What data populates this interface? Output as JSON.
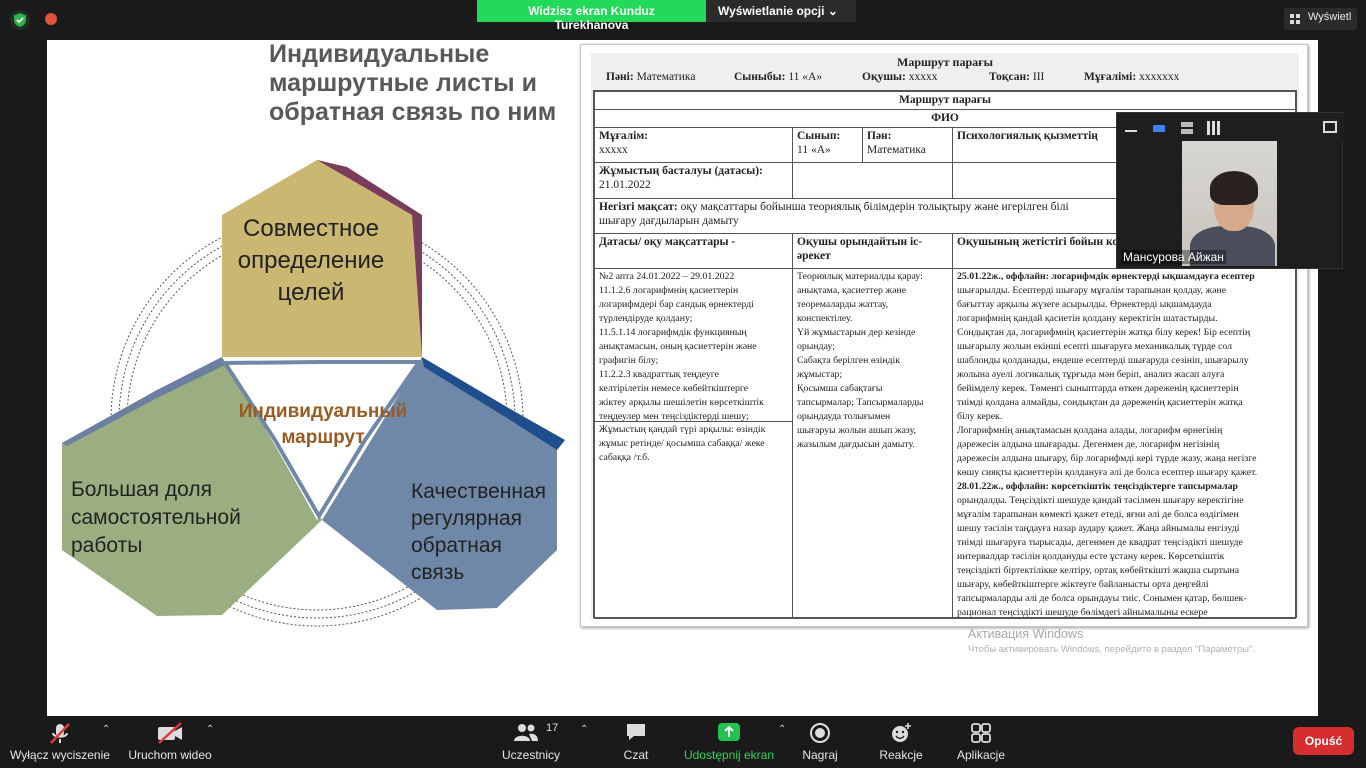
{
  "top_bar": {
    "share_banner": "Widzisz ekran Kunduz Turekhanova",
    "view_options": "Wyświetlanie opcji",
    "view_button": "Wyświetl"
  },
  "slide": {
    "title": "Индивидуальные маршрутные листы и обратная связь по ним",
    "diagram": {
      "top": [
        "Совместное",
        "определение",
        "целей"
      ],
      "left": [
        "Большая доля",
        "самостоятельной",
        "работы"
      ],
      "right": [
        "Качественная",
        "регулярная",
        "обратная",
        "связь"
      ],
      "center": [
        "Индивидуальный",
        "маршрут"
      ],
      "colors": {
        "top": "#c9b772",
        "left": "#9aae82",
        "right": "#6f88a8",
        "center_text": "#9b5a1f"
      }
    }
  },
  "document": {
    "header_title": "Маршрут парағы",
    "subject_label": "Пәні:",
    "subject_value": "Математика",
    "class_label": "Сыныбы:",
    "class_value": "11 «А»",
    "student_label": "Оқушы:",
    "student_value": "xxxxx",
    "quarter_label": "Тоқсан:",
    "quarter_value": "III",
    "teacher_label": "Мұғалімі:",
    "teacher_value": "xxxxxxx",
    "table_title": "Маршрут парағы",
    "fio": "ФИО",
    "teacher_cell_label": "Мұғалім:",
    "teacher_cell_value": "xxxxx",
    "class_cell_label": "Сынып:",
    "class_cell_value": "11 «А»",
    "subject_cell_label": "Пән:",
    "subject_cell_value": "Математика",
    "psych_label": "Психологиялық қызметтің",
    "start_label": "Жұмыстың басталуы (датасы):",
    "start_value": "21.01.2022",
    "goal_label": "Негізгі мақсат:",
    "goal_value": "оқу мақсаттары бойынша теориялық білімдерін толықтыру және игерілген білі",
    "goal_value2": "шығару дағдыларын дамыту",
    "col1_header": "Датасы/ оқу мақсаттары -",
    "col2_header": "Оқушы орындайтын іс-әрекет",
    "col3_header": "Оқушының жетістігі бойын комментарии",
    "col1_lines": [
      "№2 апта 24.01.2022 – 29.01.2022",
      "11.1.2.6 логарифмнің қасиеттерін",
      "логарифмдері бар сандық өрнектерді",
      "түрлендіруде қолдану;",
      "11.5.1.14 логарифмдік функцияның",
      "анықтамасын, оның қасиеттерін және",
      "графигін білу;",
      "11.2.2.3 квадраттық теңдеуге",
      "келтірілетін немесе көбейткіштерге",
      "жіктеу арқылы шешілетін көрсеткіштік",
      "теңдеулер мен теңсіздіктерді шешу;"
    ],
    "col1_lower": [
      "Жұмыстың қандай түрі арқылы: өзіндік",
      "жұмыс ретінде/ қосымша сабаққа/ жеке",
      "сабаққа /т.б."
    ],
    "col2_lines": [
      "Теориялық материалды қарау:",
      "анықтама, қасиеттер және",
      "теоремаларды жаттау,",
      "конспектілеу.",
      "Үй жұмыстарын дер кезінде",
      "орындау;",
      "Сабақта берілген өзіндік",
      "жұмыстар;",
      "Қосымша сабақтағы",
      "тапсырмалар; Тапсырмаларды",
      "орындауда толығымен",
      "шығаруы жолын ашып жазу,",
      "жазылым дағдысын дамыту."
    ],
    "col3_lines": [
      "25.01.22ж., оффлайн: логарифмдік өрнектерді ықшамдауға есептер",
      "шығарылды. Есептерді шығару мұғалім тарапынан қолдау, және",
      "бағыттау арқылы жүзеге асырылды. Өрнектерді ықшамдауда",
      "логарифмнің қандай қасиетін қолдану керектігін шатастырды.",
      "Сондықтан да, логарифмнің қасиеттерін жатқа білу керек! Бір есептің",
      "шығарылу жолын екінші есепті шығаруға механикалық түрде сол",
      "шаблонды қолданады, ендеше есептерді шығаруда сезініп, шығарылу",
      "жолына әуелі логикалық тұрғыда мән беріп, анализ жасап алуға",
      "бейімделу керек. Төменгі сыныптарда өткен дәреженің қасиеттерін",
      "тиімді қолдана алмайды, сондықтан да дәреженің қасиеттерін жатқа",
      "білу керек.",
      "Логарифмнің анықтамасын қолдана алады, логарифм өрнегінің",
      "дәрежесін алдына шығарады. Дегенмен де, логарифм негізінің",
      "дәрежесін алдына шығару, бір логарифмді кері түрде жазу, жаңа негізге",
      "көшу сияқты қасиеттерін қолдануға әлі де болса есептер шығару қажет.",
      "28.01.22ж., оффлайн: көрсеткіштік теңсіздіктерге тапсырмалар",
      "орындалды. Теңсіздікті шешуде қандай тәсілмен шығару керектігіне",
      "мұғалім тарапынан көмекті қажет етеді, яғни әлі де болса өздігімен",
      "шешу тәсілін таңдауға назар аудару қажет. Жаңа айнымалы енгізуді",
      "тиімді шығаруға тырысады, дегенмен де квадрат теңсіздікті шешуде",
      "интервалдар тәсілін қолдануды есте ұстану керек. Көрсеткіштік",
      "теңсіздікті біртектілікке келтіру, ортақ көбейткішті жақша сыртына",
      "шығару, көбейткіштерге жіктеуге байланысты орта деңгейлі",
      "тапсырмаларды әлі де болса орындауы тиіс. Сонымен қатар, бөлшек-",
      "рационал теңсіздікті шешуде бөлімдегі айнымалыны ескере"
    ]
  },
  "self_view": {
    "name": "Мансурова Айжан"
  },
  "watermark": {
    "line1": "Активация Windows",
    "line2": "Чтобы активировать Windows, перейдите в раздел \"Параметры\"."
  },
  "toolbar": {
    "mute": "Wyłącz wyciszenie",
    "video": "Uruchom wideo",
    "participants": "Uczestnicy",
    "participants_count": "17",
    "chat": "Czat",
    "share": "Udostępnij ekran",
    "record": "Nagraj",
    "reactions": "Reakcje",
    "apps": "Aplikacje",
    "end": "Opuść"
  }
}
